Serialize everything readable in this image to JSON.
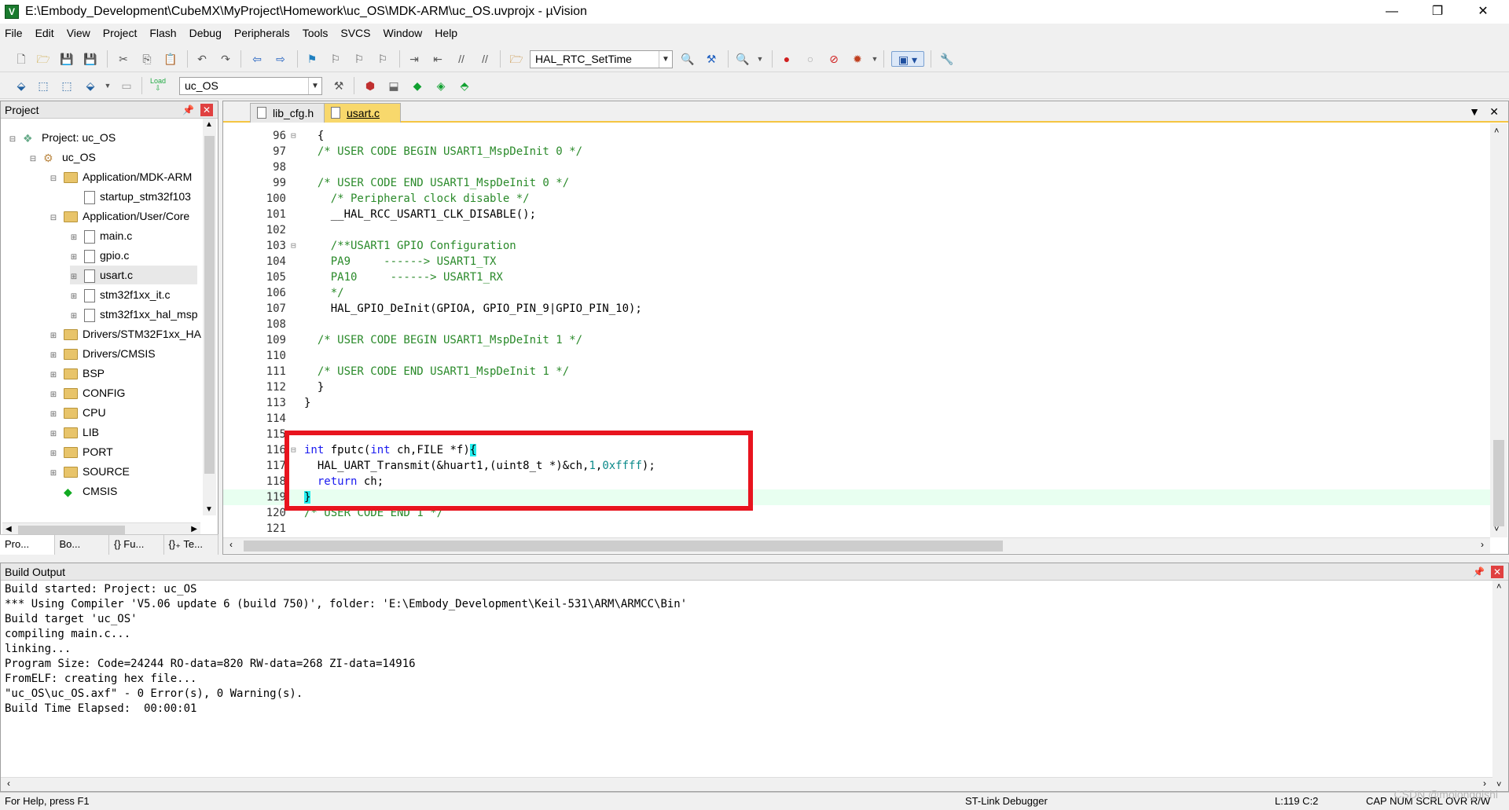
{
  "window": {
    "title": "E:\\Embody_Development\\CubeMX\\MyProject\\Homework\\uc_OS\\MDK-ARM\\uc_OS.uvprojx - µVision",
    "minimize": "—",
    "maximize": "❐",
    "close": "✕"
  },
  "menu": [
    "File",
    "Edit",
    "View",
    "Project",
    "Flash",
    "Debug",
    "Peripherals",
    "Tools",
    "SVCS",
    "Window",
    "Help"
  ],
  "toolbar": {
    "function_combo": "HAL_RTC_SetTime",
    "target_combo": "uc_OS",
    "load_label": "Load"
  },
  "project_panel": {
    "title": "Project",
    "pin": "📌",
    "close": "✕",
    "tree": [
      {
        "label": "Project: uc_OS",
        "level": 0,
        "icon": "project-icon",
        "exp": "⊟"
      },
      {
        "label": "uc_OS",
        "level": 1,
        "icon": "target-icon",
        "exp": "⊟"
      },
      {
        "label": "Application/MDK-ARM",
        "level": 2,
        "icon": "folder-icon",
        "exp": "⊟"
      },
      {
        "label": "startup_stm32f103",
        "level": 3,
        "icon": "file-icon",
        "exp": ""
      },
      {
        "label": "Application/User/Core",
        "level": 2,
        "icon": "folder-icon",
        "exp": "⊟"
      },
      {
        "label": "main.c",
        "level": 3,
        "icon": "file-icon",
        "exp": "⊞"
      },
      {
        "label": "gpio.c",
        "level": 3,
        "icon": "file-icon",
        "exp": "⊞"
      },
      {
        "label": "usart.c",
        "level": 3,
        "icon": "file-icon",
        "exp": "⊞"
      },
      {
        "label": "stm32f1xx_it.c",
        "level": 3,
        "icon": "file-icon",
        "exp": "⊞"
      },
      {
        "label": "stm32f1xx_hal_msp",
        "level": 3,
        "icon": "file-icon",
        "exp": "⊞"
      },
      {
        "label": "Drivers/STM32F1xx_HA",
        "level": 2,
        "icon": "folder-icon",
        "exp": "⊞"
      },
      {
        "label": "Drivers/CMSIS",
        "level": 2,
        "icon": "folder-icon",
        "exp": "⊞"
      },
      {
        "label": "BSP",
        "level": 2,
        "icon": "folder-icon",
        "exp": "⊞"
      },
      {
        "label": "CONFIG",
        "level": 2,
        "icon": "folder-icon",
        "exp": "⊞"
      },
      {
        "label": "CPU",
        "level": 2,
        "icon": "folder-icon",
        "exp": "⊞"
      },
      {
        "label": "LIB",
        "level": 2,
        "icon": "folder-icon",
        "exp": "⊞"
      },
      {
        "label": "PORT",
        "level": 2,
        "icon": "folder-icon",
        "exp": "⊞"
      },
      {
        "label": "SOURCE",
        "level": 2,
        "icon": "folder-icon",
        "exp": "⊞"
      },
      {
        "label": "CMSIS",
        "level": 2,
        "icon": "cmsis-icon",
        "exp": ""
      }
    ],
    "tabs": [
      "Pro...",
      "Bo...",
      "{} Fu...",
      "{}₊ Te..."
    ]
  },
  "editor": {
    "tabs": [
      "lib_cfg.h",
      "usart.c"
    ],
    "active_tab": "usart.c",
    "lines": [
      {
        "n": "96",
        "fold": "⊟",
        "parts": [
          [
            "",
            "  {"
          ]
        ]
      },
      {
        "n": "97",
        "fold": "",
        "parts": [
          [
            "cm",
            "  /* USER CODE BEGIN USART1_MspDeInit 0 */"
          ]
        ]
      },
      {
        "n": "98",
        "fold": "",
        "parts": [
          [
            "",
            ""
          ]
        ]
      },
      {
        "n": "99",
        "fold": "",
        "parts": [
          [
            "cm",
            "  /* USER CODE END USART1_MspDeInit 0 */"
          ]
        ]
      },
      {
        "n": "100",
        "fold": "",
        "parts": [
          [
            "cm",
            "    /* Peripheral clock disable */"
          ]
        ]
      },
      {
        "n": "101",
        "fold": "",
        "parts": [
          [
            "",
            "    __HAL_RCC_USART1_CLK_DISABLE();"
          ]
        ]
      },
      {
        "n": "102",
        "fold": "",
        "parts": [
          [
            "",
            ""
          ]
        ]
      },
      {
        "n": "103",
        "fold": "⊟",
        "parts": [
          [
            "cm",
            "    /**USART1 GPIO Configuration"
          ]
        ]
      },
      {
        "n": "104",
        "fold": "",
        "parts": [
          [
            "cm",
            "    PA9     ------> USART1_TX"
          ]
        ]
      },
      {
        "n": "105",
        "fold": "",
        "parts": [
          [
            "cm",
            "    PA10     ------> USART1_RX"
          ]
        ]
      },
      {
        "n": "106",
        "fold": "",
        "parts": [
          [
            "cm",
            "    */"
          ]
        ]
      },
      {
        "n": "107",
        "fold": "",
        "parts": [
          [
            "",
            "    HAL_GPIO_DeInit(GPIOA, GPIO_PIN_9|GPIO_PIN_10);"
          ]
        ]
      },
      {
        "n": "108",
        "fold": "",
        "parts": [
          [
            "",
            ""
          ]
        ]
      },
      {
        "n": "109",
        "fold": "",
        "parts": [
          [
            "cm",
            "  /* USER CODE BEGIN USART1_MspDeInit 1 */"
          ]
        ]
      },
      {
        "n": "110",
        "fold": "",
        "parts": [
          [
            "",
            ""
          ]
        ]
      },
      {
        "n": "111",
        "fold": "",
        "parts": [
          [
            "cm",
            "  /* USER CODE END USART1_MspDeInit 1 */"
          ]
        ]
      },
      {
        "n": "112",
        "fold": "",
        "parts": [
          [
            "",
            "  }"
          ]
        ]
      },
      {
        "n": "113",
        "fold": "",
        "parts": [
          [
            "",
            "}"
          ]
        ]
      },
      {
        "n": "114",
        "fold": "",
        "parts": [
          [
            "",
            ""
          ]
        ]
      },
      {
        "n": "115",
        "fold": "",
        "parts": [
          [
            "",
            ""
          ]
        ]
      },
      {
        "n": "116",
        "fold": "⊟",
        "parts": [
          [
            "kw",
            "int"
          ],
          [
            "",
            " fputc("
          ],
          [
            "kw",
            "int"
          ],
          [
            "",
            " ch,FILE *f)"
          ],
          [
            "br",
            "{"
          ]
        ]
      },
      {
        "n": "117",
        "fold": "",
        "parts": [
          [
            "",
            "  HAL_UART_Transmit(&huart1,(uint8_t *)&ch,"
          ],
          [
            "nm",
            "1"
          ],
          [
            "",
            ","
          ],
          [
            "nm",
            "0xffff"
          ],
          [
            "",
            ");"
          ]
        ]
      },
      {
        "n": "118",
        "fold": "",
        "parts": [
          [
            "",
            "  "
          ],
          [
            "kw",
            "return"
          ],
          [
            "",
            " ch;"
          ]
        ]
      },
      {
        "n": "119",
        "fold": "",
        "parts": [
          [
            "br",
            "}"
          ]
        ],
        "hl": true
      },
      {
        "n": "120",
        "fold": "",
        "parts": [
          [
            "cm",
            "/* USER CODE END 1 */"
          ]
        ]
      },
      {
        "n": "121",
        "fold": "",
        "parts": [
          [
            "",
            ""
          ]
        ]
      }
    ]
  },
  "build_output": {
    "title": "Build Output",
    "pin": "📌",
    "close": "✕",
    "lines": [
      "Build started: Project: uc_OS",
      "*** Using Compiler 'V5.06 update 6 (build 750)', folder: 'E:\\Embody_Development\\Keil-531\\ARM\\ARMCC\\Bin'",
      "Build target 'uc_OS'",
      "compiling main.c...",
      "linking...",
      "Program Size: Code=24244 RO-data=820 RW-data=268 ZI-data=14916",
      "FromELF: creating hex file...",
      "\"uc_OS\\uc_OS.axf\" - 0 Error(s), 0 Warning(s).",
      "Build Time Elapsed:  00:00:01"
    ]
  },
  "status": {
    "help": "For Help, press F1",
    "debugger": "ST-Link Debugger",
    "position": "L:119 C:2",
    "keys": "CAP  NUM  SCRL  OVR  R/W"
  },
  "watermark": "CSDN @molongqishi"
}
